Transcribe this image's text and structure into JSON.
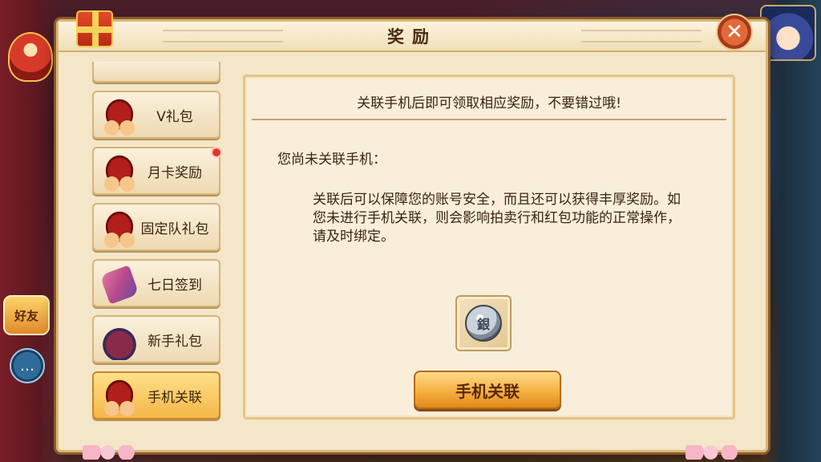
{
  "dialog": {
    "title": "奖励"
  },
  "sidebar": {
    "items": [
      {
        "label": "V礼包",
        "icon": "red-basket-icon",
        "active": false,
        "badge": false
      },
      {
        "label": "月卡奖励",
        "icon": "red-basket-icon",
        "active": false,
        "badge": true
      },
      {
        "label": "固定队礼包",
        "icon": "red-basket-icon",
        "active": false,
        "badge": false
      },
      {
        "label": "七日签到",
        "icon": "scroll-icon",
        "active": false,
        "badge": false
      },
      {
        "label": "新手礼包",
        "icon": "lucky-bag-icon",
        "active": false,
        "badge": false
      },
      {
        "label": "手机关联",
        "icon": "red-basket-icon",
        "active": true,
        "badge": false
      }
    ]
  },
  "content": {
    "header": "关联手机后即可领取相应奖励，不要错过哦!",
    "status": "您尚未关联手机：",
    "description": "关联后可以保障您的账号安全，而且还可以获得丰厚奖励。如您未进行手机关联，则会影响拍卖行和红包功能的正常操作，请及时绑定。",
    "reward_icon": "silver-coin-icon",
    "coin_symbol": "銀",
    "button_label": "手机关联"
  },
  "hud": {
    "friend_label": "好友",
    "chat_icon": "chat-bubble-icon"
  },
  "colors": {
    "panel_bg": "#f4e6c8",
    "accent_button": "#f6b040",
    "text": "#3a2410",
    "badge_red": "#e8342a"
  }
}
